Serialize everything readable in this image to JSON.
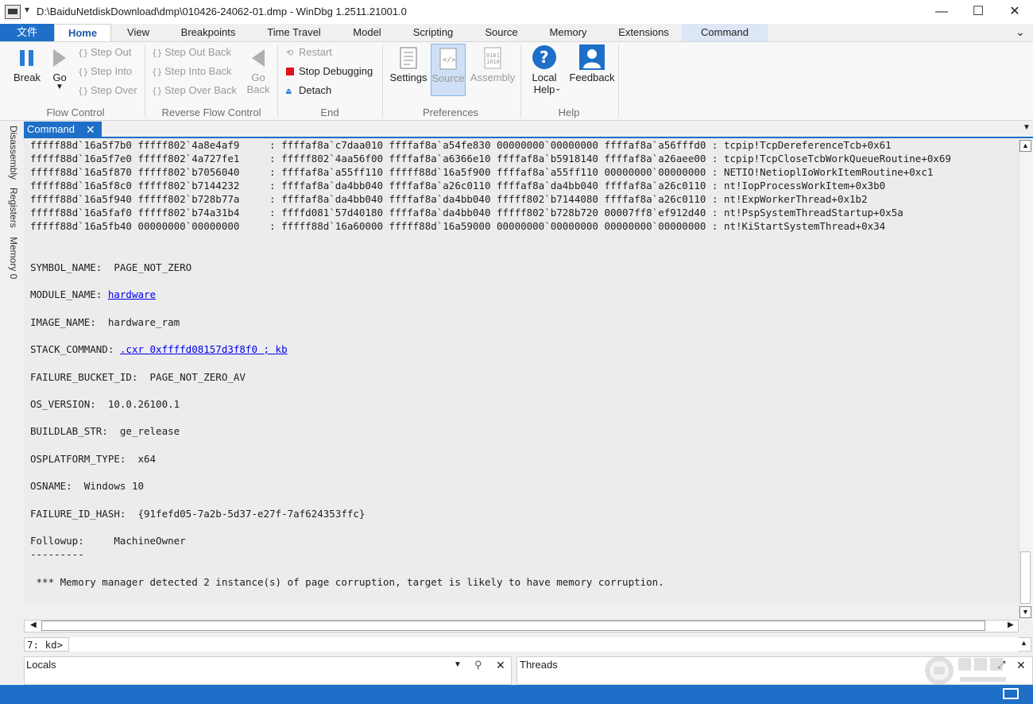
{
  "window": {
    "title": "D:\\BaiduNetdiskDownload\\dmp\\010426-24062-01.dmp - WinDbg 1.2511.21001.0",
    "minimize": "—",
    "maximize": "☐",
    "close": "✕"
  },
  "ribbon_tabs": [
    "文件",
    "Home",
    "View",
    "Breakpoints",
    "Time Travel",
    "Model",
    "Scripting",
    "Source",
    "Memory",
    "Extensions",
    "Command"
  ],
  "ribbon": {
    "flow_control": {
      "label": "Flow Control",
      "break": "Break",
      "go": "Go",
      "step_out": "Step Out",
      "step_into": "Step Into",
      "step_over": "Step Over"
    },
    "reverse_flow_control": {
      "label": "Reverse Flow Control",
      "step_out_back": "Step Out Back",
      "step_into_back": "Step Into Back",
      "step_over_back": "Step Over Back",
      "go_back_1": "Go",
      "go_back_2": "Back"
    },
    "end": {
      "label": "End",
      "restart": "Restart",
      "stop_debugging": "Stop Debugging",
      "detach": "Detach"
    },
    "preferences": {
      "label": "Preferences",
      "settings": "Settings",
      "source": "Source",
      "assembly": "Assembly"
    },
    "help": {
      "label": "Help",
      "local_help_1": "Local",
      "local_help_2": "Help",
      "feedback": "Feedback"
    }
  },
  "side_tabs": [
    "Disassembly",
    "Registers",
    "Memory 0"
  ],
  "command_window": {
    "tab_label": "Command",
    "stack_lines": [
      "fffff88d`16a5f7b0 fffff802`4a8e4af9     : ffffaf8a`c7daa010 ffffaf8a`a54fe830 00000000`00000000 ffffaf8a`a56fffd0 : tcpip!TcpDereferenceTcb+0x61",
      "fffff88d`16a5f7e0 fffff802`4a727fe1     : fffff802`4aa56f00 ffffaf8a`a6366e10 ffffaf8a`b5918140 ffffaf8a`a26aee00 : tcpip!TcpCloseTcbWorkQueueRoutine+0x69",
      "fffff88d`16a5f870 fffff802`b7056040     : ffffaf8a`a55ff110 fffff88d`16a5f900 ffffaf8a`a55ff110 00000000`00000000 : NETIO!NetioplIoWorkItemRoutine+0xc1",
      "fffff88d`16a5f8c0 fffff802`b7144232     : ffffaf8a`da4bb040 ffffaf8a`a26c0110 ffffaf8a`da4bb040 ffffaf8a`a26c0110 : nt!IopProcessWorkItem+0x3b0",
      "fffff88d`16a5f940 fffff802`b728b77a     : ffffaf8a`da4bb040 ffffaf8a`da4bb040 fffff802`b7144080 ffffaf8a`a26c0110 : nt!ExpWorkerThread+0x1b2",
      "fffff88d`16a5faf0 fffff802`b74a31b4     : ffffd081`57d40180 ffffaf8a`da4bb040 fffff802`b728b720 00007ff8`ef912d40 : nt!PspSystemThreadStartup+0x5a",
      "fffff88d`16a5fb40 00000000`00000000     : fffff88d`16a60000 fffff88d`16a59000 00000000`00000000 00000000`00000000 : nt!KiStartSystemThread+0x34"
    ],
    "symbol_name_key": "SYMBOL_NAME:  ",
    "symbol_name_val": "PAGE_NOT_ZERO",
    "module_name_key": "MODULE_NAME: ",
    "module_name_val": "hardware",
    "image_name_key": "IMAGE_NAME:  ",
    "image_name_val": "hardware_ram",
    "stack_command_key": "STACK_COMMAND: ",
    "stack_command_val": ".cxr 0xffffd08157d3f8f0 ; kb",
    "failure_bucket_key": "FAILURE_BUCKET_ID:  ",
    "failure_bucket_val": "PAGE_NOT_ZERO_AV",
    "os_version_key": "OS_VERSION:  ",
    "os_version_val": "10.0.26100.1",
    "buildlab_key": "BUILDLAB_STR:  ",
    "buildlab_val": "ge_release",
    "osplatform_key": "OSPLATFORM_TYPE:  ",
    "osplatform_val": "x64",
    "osname_key": "OSNAME:  ",
    "osname_val": "Windows 10",
    "failure_id_key": "FAILURE_ID_HASH:  ",
    "failure_id_val": "{91fefd05-7a2b-5d37-e27f-7af624353ffc}",
    "followup_key": "Followup:     ",
    "followup_val": "MachineOwner",
    "separator": "---------",
    "memory_warning": " *** Memory manager detected 2 instance(s) of page corruption, target is likely to have memory corruption."
  },
  "prompt": {
    "label": "7: kd>",
    "value": ""
  },
  "panes": {
    "locals": "Locals",
    "threads": "Threads"
  },
  "colors": {
    "accent": "#1d6fc8",
    "link": "#0000ee"
  }
}
